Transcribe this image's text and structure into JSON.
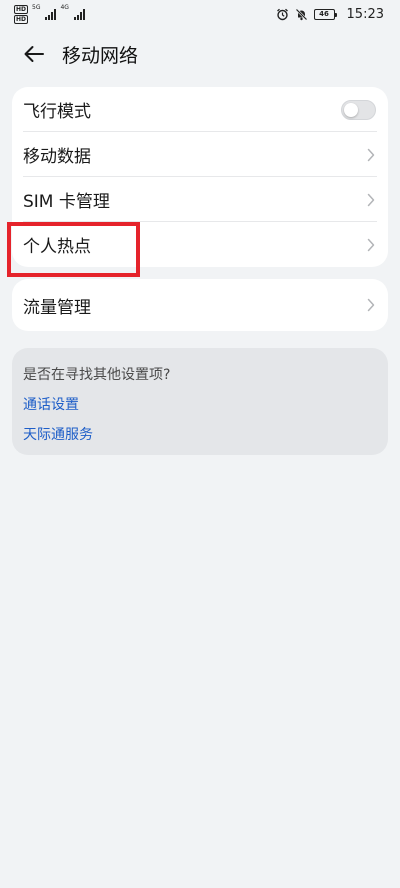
{
  "status_bar": {
    "hd_1": "HD",
    "hd_2": "HD",
    "sig1_tag": "5G",
    "sig2_tag": "4G",
    "battery": "46",
    "time": "15:23"
  },
  "header": {
    "title": "移动网络"
  },
  "main_card": {
    "airplane_label": "飞行模式",
    "airplane_on": false,
    "mobile_data_label": "移动数据",
    "sim_label": "SIM 卡管理",
    "hotspot_label": "个人热点"
  },
  "traffic_card": {
    "label": "流量管理"
  },
  "suggestions": {
    "question": "是否在寻找其他设置项?",
    "links": [
      "通话设置",
      "天际通服务"
    ]
  },
  "colors": {
    "highlight": "#e5232b",
    "link": "#1e5ec8"
  }
}
